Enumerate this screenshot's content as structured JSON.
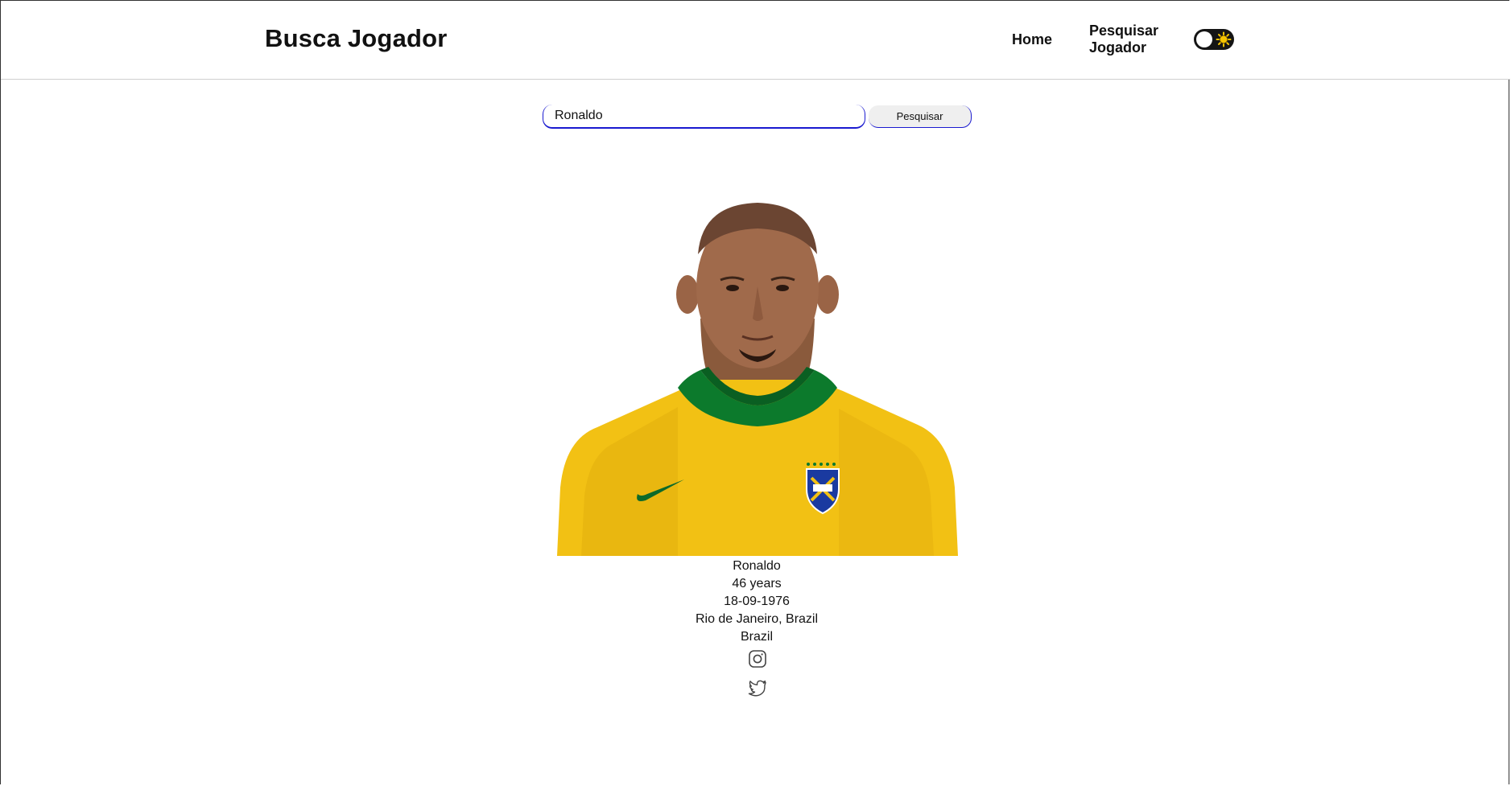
{
  "header": {
    "brand": "Busca Jogador",
    "nav": {
      "home": "Home",
      "search_player": "Pesquisar Jogador"
    },
    "theme_toggle_icon": "sun-icon"
  },
  "search": {
    "value": "Ronaldo",
    "button_label": "Pesquisar"
  },
  "player": {
    "name": "Ronaldo",
    "age": "46 years",
    "birth_date": "18-09-1976",
    "birth_place": "Rio de Janeiro, Brazil",
    "nationality": "Brazil",
    "social_icons": [
      "instagram-icon",
      "twitter-icon"
    ]
  },
  "colors": {
    "accent": "#1a1ad0",
    "jersey_yellow": "#f2c114",
    "jersey_green": "#0c7a2c",
    "toggle_bg": "#151515",
    "sun": "#f5c400"
  }
}
